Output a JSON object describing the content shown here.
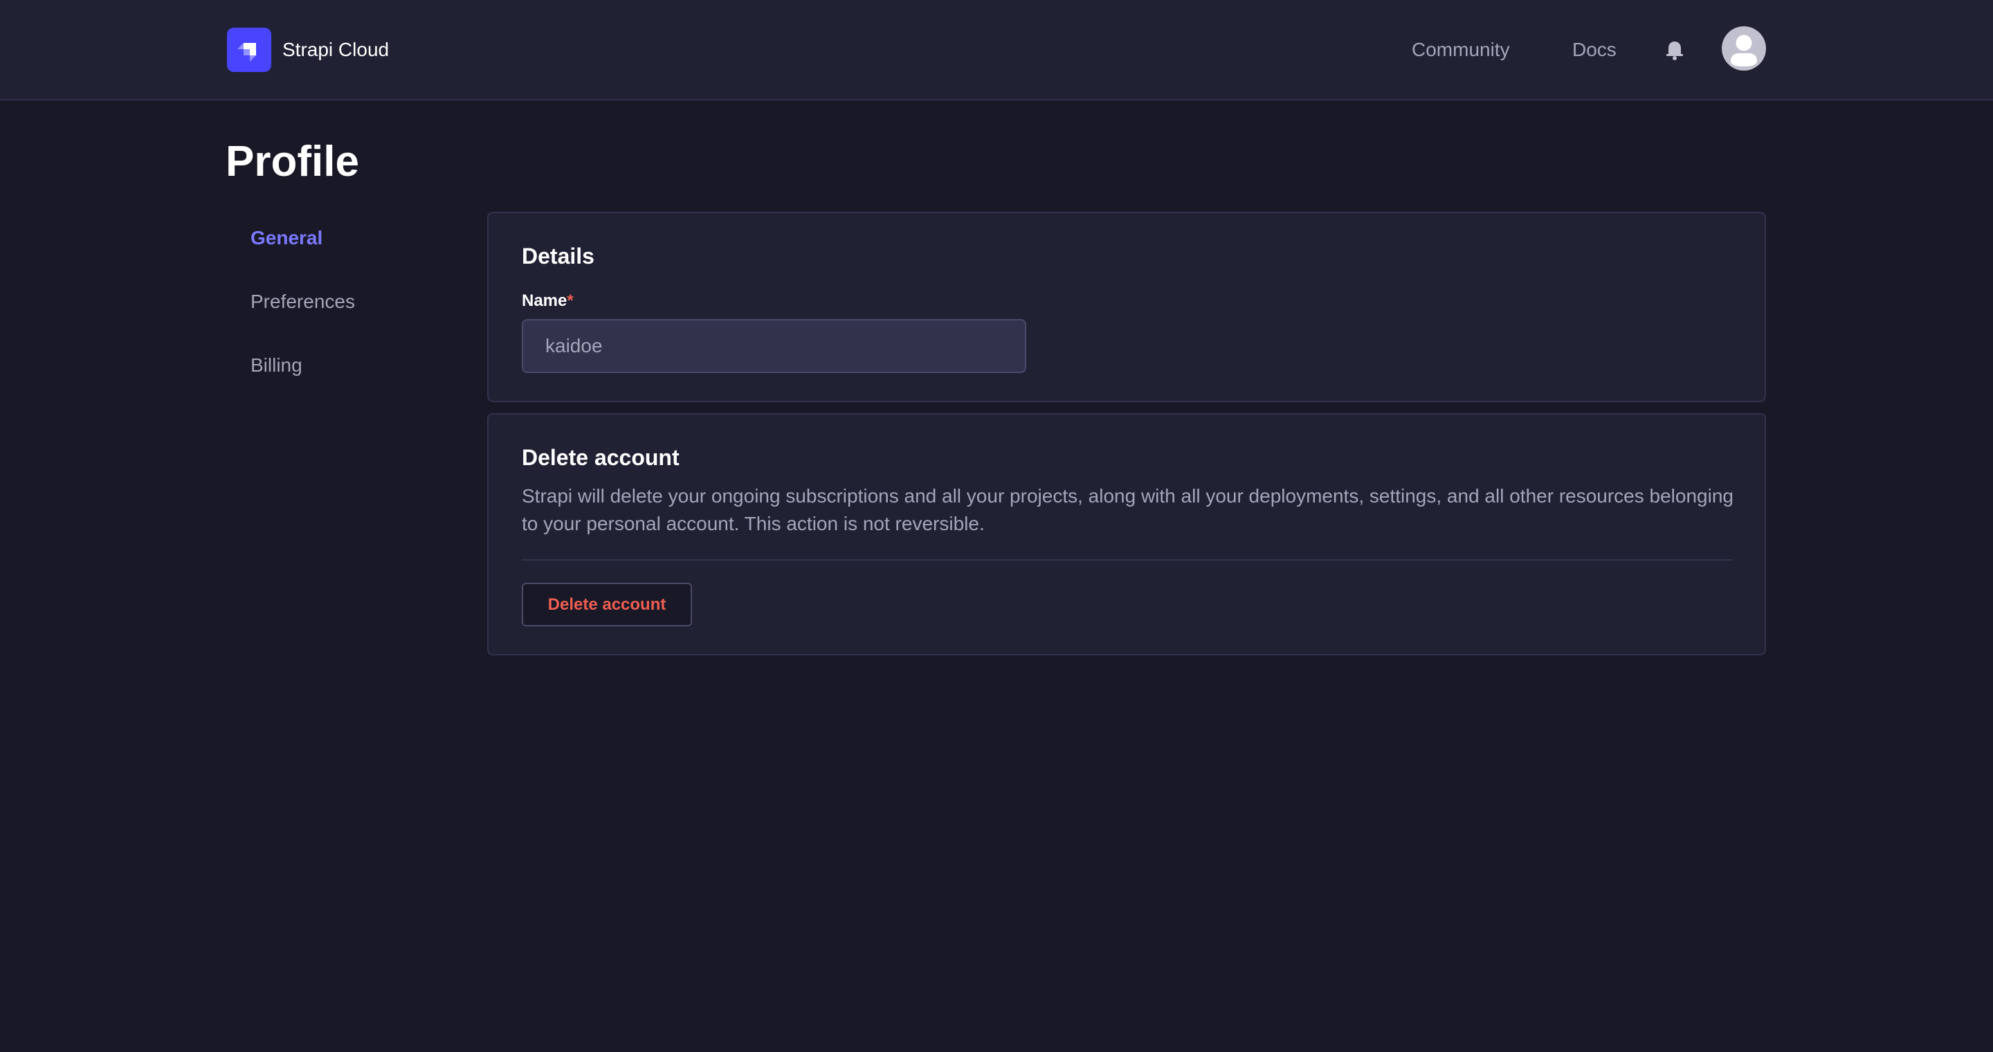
{
  "header": {
    "brand_name": "Strapi Cloud",
    "logo_icon": "strapi-logo-icon",
    "nav_links": [
      {
        "label": "Community"
      },
      {
        "label": "Docs"
      }
    ],
    "notifications_icon": "bell-icon",
    "avatar_icon": "user-avatar-icon"
  },
  "page": {
    "title": "Profile"
  },
  "sidebar": {
    "items": [
      {
        "label": "General",
        "active": true
      },
      {
        "label": "Preferences",
        "active": false
      },
      {
        "label": "Billing",
        "active": false
      }
    ]
  },
  "details_card": {
    "title": "Details",
    "name_label": "Name",
    "required_marker": "*",
    "name_value": "kaidoe"
  },
  "delete_card": {
    "title": "Delete account",
    "description": "Strapi will delete your ongoing subscriptions and all your projects, along with all your deployments, settings, and all other resources belonging to your personal account. This action is not reversible.",
    "button_label": "Delete account"
  },
  "colors": {
    "accent": "#7b79ff",
    "brand": "#4945ff",
    "danger": "#ee5e52",
    "background": "#181826",
    "surface": "#212134"
  }
}
